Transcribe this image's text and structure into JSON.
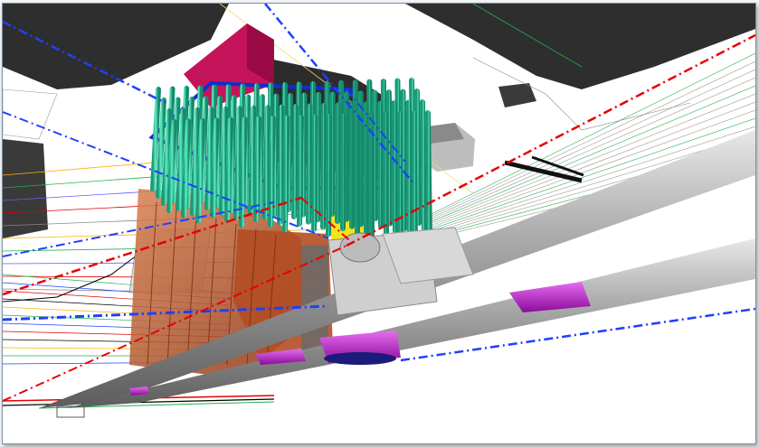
{
  "viewer": {
    "type": "3d-bim-viewport",
    "background": "#ffffff",
    "colors": {
      "building_dark": "#2e2e2e",
      "pile_cap_red": "#c5135a",
      "piles_teal": "#2fd3a8",
      "cap_outline_blue": "#0c2fd1",
      "utility_pipes_gray": "#a8a8a8",
      "tunnel_magenta": "#c81fd8",
      "column_yellow": "#f4e21a",
      "foundation_orange": "#c35a2a",
      "line_red": "#e60000",
      "line_blue": "#1f3fff",
      "line_green": "#22b14c"
    }
  }
}
